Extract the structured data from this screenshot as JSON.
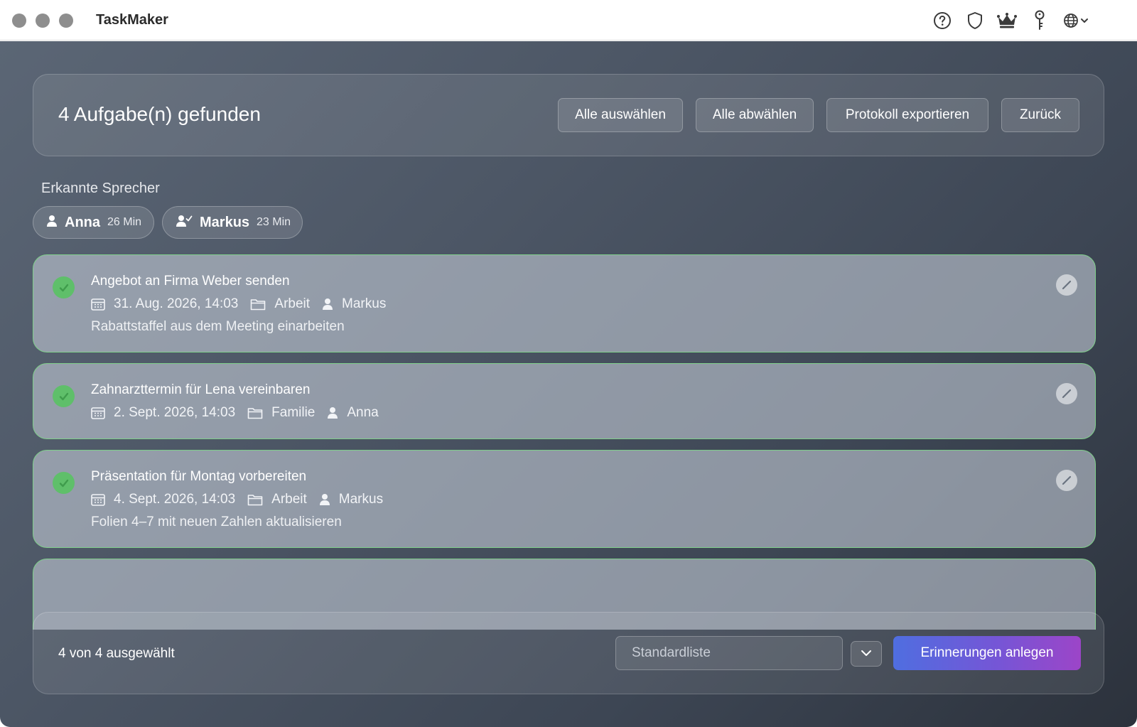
{
  "app": {
    "title": "TaskMaker"
  },
  "toolbar": {
    "icons": [
      "help-circle-icon",
      "shield-icon",
      "crown-icon",
      "key-icon",
      "globe-icon",
      "chevron-down-icon"
    ]
  },
  "header": {
    "title": "4 Aufgabe(n) gefunden",
    "buttons": {
      "select_all": "Alle auswählen",
      "deselect_all": "Alle abwählen",
      "export_protocol": "Protokoll exportieren",
      "back": "Zurück"
    }
  },
  "speakers": {
    "label": "Erkannte Sprecher",
    "items": [
      {
        "name": "Anna",
        "duration": "26 Min",
        "icon": "person-icon"
      },
      {
        "name": "Markus",
        "duration": "23 Min",
        "icon": "person-check-icon"
      }
    ]
  },
  "tasks": [
    {
      "title": "Angebot an Firma Weber senden",
      "date": "31. Aug. 2026, 14:03",
      "category": "Arbeit",
      "assignee": "Markus",
      "note": "Rabattstaffel aus dem Meeting einarbeiten",
      "selected": true
    },
    {
      "title": "Zahnarzttermin für Lena vereinbaren",
      "date": "2. Sept. 2026, 14:03",
      "category": "Familie",
      "assignee": "Anna",
      "note": "",
      "selected": true
    },
    {
      "title": "Präsentation für Montag vorbereiten",
      "date": "4. Sept. 2026, 14:03",
      "category": "Arbeit",
      "assignee": "Markus",
      "note": "Folien 4–7 mit neuen Zahlen aktualisieren",
      "selected": true
    }
  ],
  "footer": {
    "selection": "4 von 4 ausgewählt",
    "list_placeholder": "Standardliste",
    "create_button": "Erinnerungen anlegen"
  },
  "colors": {
    "accent_start": "#4f6ee0",
    "accent_end": "#9c45c8",
    "check_green": "#5fbf6a",
    "task_border": "#7fcf8a"
  }
}
